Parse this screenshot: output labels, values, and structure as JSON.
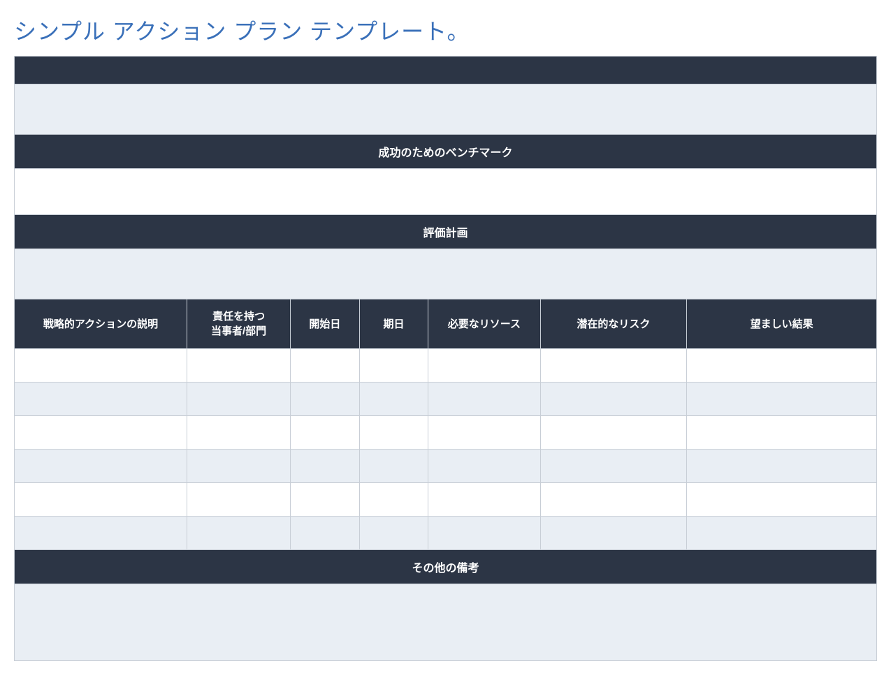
{
  "title": "シンプル アクション プラン テンプレート。",
  "sections": {
    "benchmark_header": "成功のためのベンチマーク",
    "evaluation_header": "評価計画",
    "notes_header": "その他の備考"
  },
  "table": {
    "headers": {
      "c1": "戦略的アクションの説明",
      "c2": "責任を持つ\n当事者/部門",
      "c3": "開始日",
      "c4": "期日",
      "c5": "必要なリソース",
      "c6": "潜在的なリスク",
      "c7": "望ましい結果"
    },
    "rows": [
      {
        "c1": "",
        "c2": "",
        "c3": "",
        "c4": "",
        "c5": "",
        "c6": "",
        "c7": ""
      },
      {
        "c1": "",
        "c2": "",
        "c3": "",
        "c4": "",
        "c5": "",
        "c6": "",
        "c7": ""
      },
      {
        "c1": "",
        "c2": "",
        "c3": "",
        "c4": "",
        "c5": "",
        "c6": "",
        "c7": ""
      },
      {
        "c1": "",
        "c2": "",
        "c3": "",
        "c4": "",
        "c5": "",
        "c6": "",
        "c7": ""
      },
      {
        "c1": "",
        "c2": "",
        "c3": "",
        "c4": "",
        "c5": "",
        "c6": "",
        "c7": ""
      },
      {
        "c1": "",
        "c2": "",
        "c3": "",
        "c4": "",
        "c5": "",
        "c6": "",
        "c7": ""
      }
    ]
  },
  "blanks": {
    "top1": "",
    "top2": "",
    "benchmark_body": "",
    "evaluation_body": "",
    "notes_body": ""
  }
}
